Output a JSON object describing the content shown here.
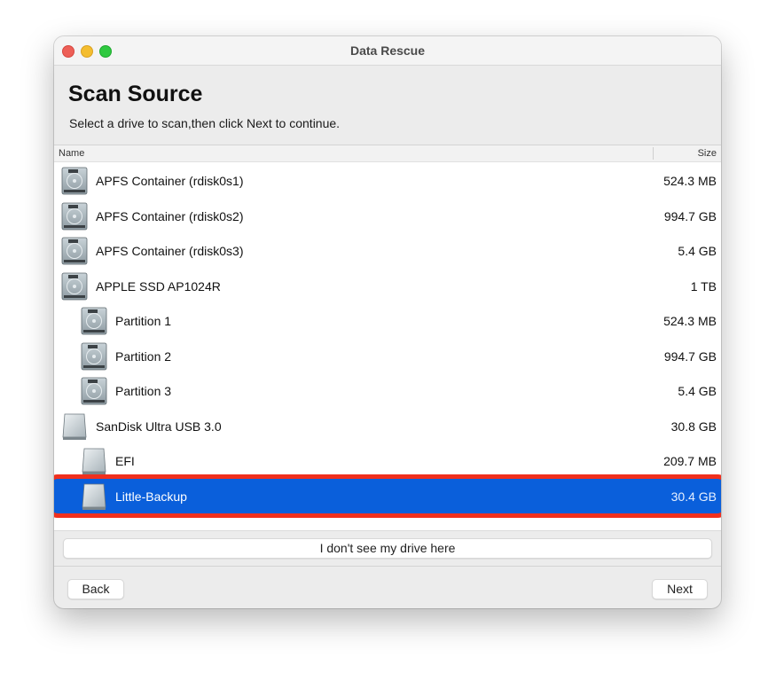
{
  "window": {
    "title": "Data Rescue",
    "traffic_lights": [
      "close",
      "minimize",
      "zoom"
    ]
  },
  "header": {
    "heading": "Scan Source",
    "subtitle": "Select a drive to scan,then click Next to continue."
  },
  "table": {
    "columns": {
      "name": "Name",
      "size": "Size"
    },
    "rows": [
      {
        "name": "APFS Container (rdisk0s1)",
        "size": "524.3 MB",
        "icon": "internal-disk-icon",
        "level": 0,
        "selected": false
      },
      {
        "name": "APFS Container (rdisk0s2)",
        "size": "994.7 GB",
        "icon": "internal-disk-icon",
        "level": 0,
        "selected": false
      },
      {
        "name": "APFS Container (rdisk0s3)",
        "size": "5.4 GB",
        "icon": "internal-disk-icon",
        "level": 0,
        "selected": false
      },
      {
        "name": "APPLE SSD AP1024R",
        "size": "1 TB",
        "icon": "internal-disk-icon",
        "level": 0,
        "selected": false
      },
      {
        "name": "Partition 1",
        "size": "524.3 MB",
        "icon": "internal-disk-icon",
        "level": 1,
        "selected": false
      },
      {
        "name": "Partition 2",
        "size": "994.7 GB",
        "icon": "internal-disk-icon",
        "level": 1,
        "selected": false
      },
      {
        "name": "Partition 3",
        "size": "5.4 GB",
        "icon": "internal-disk-icon",
        "level": 1,
        "selected": false
      },
      {
        "name": "SanDisk Ultra USB 3.0",
        "size": "30.8 GB",
        "icon": "external-disk-icon",
        "level": 0,
        "selected": false
      },
      {
        "name": "EFI",
        "size": "209.7 MB",
        "icon": "external-disk-icon",
        "level": 1,
        "selected": false
      },
      {
        "name": "Little-Backup",
        "size": "30.4 GB",
        "icon": "external-disk-icon",
        "level": 1,
        "selected": true
      }
    ]
  },
  "buttons": {
    "no_drive": "I don't see my drive here",
    "back": "Back",
    "next": "Next"
  },
  "colors": {
    "selection": "#0a5fdb",
    "highlight_outline": "#f0301e"
  }
}
